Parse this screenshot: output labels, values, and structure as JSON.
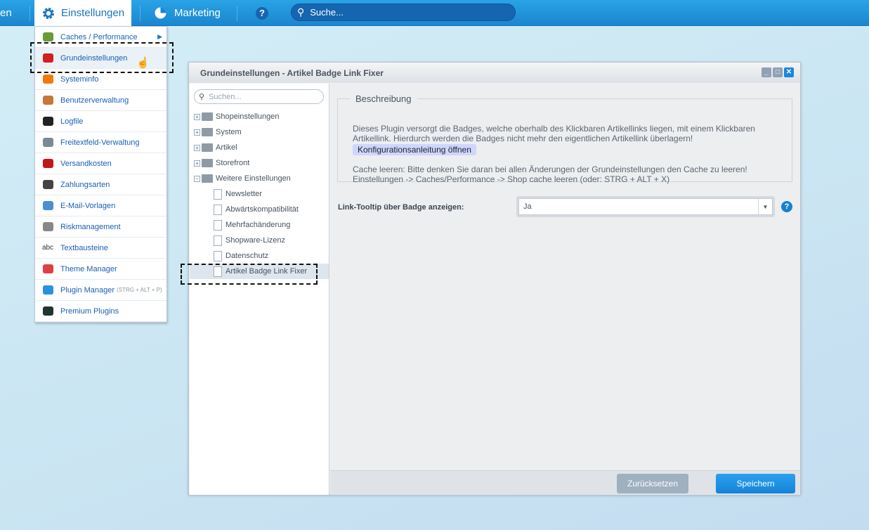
{
  "topbar": {
    "partial_item": "en",
    "settings": "Einstellungen",
    "marketing": "Marketing",
    "search_placeholder": "Suche..."
  },
  "menu": {
    "items": [
      {
        "label": "Caches / Performance",
        "icon": "gauge-icon",
        "submenu": true
      },
      {
        "label": "Grundeinstellungen",
        "icon": "wrench-icon",
        "highlighted": true
      },
      {
        "label": "Systeminfo",
        "icon": "lightning-icon"
      },
      {
        "label": "Benutzerverwaltung",
        "icon": "user-icon"
      },
      {
        "label": "Logfile",
        "icon": "terminal-icon"
      },
      {
        "label": "Freitextfeld-Verwaltung",
        "icon": "field-add-icon"
      },
      {
        "label": "Versandkosten",
        "icon": "truck-icon"
      },
      {
        "label": "Zahlungsarten",
        "icon": "credit-card-icon"
      },
      {
        "label": "E-Mail-Vorlagen",
        "icon": "email-icon"
      },
      {
        "label": "Riskmanagement",
        "icon": "filter-icon"
      },
      {
        "label": "Textbausteine",
        "icon": "abc-icon"
      },
      {
        "label": "Theme Manager",
        "icon": "palette-icon"
      },
      {
        "label": "Plugin Manager",
        "shortcut": "(STRG + ALT + P)",
        "icon": "puzzle-icon"
      },
      {
        "label": "Premium Plugins",
        "icon": "shopware-icon"
      }
    ]
  },
  "window": {
    "title": "Grundeinstellungen - Artikel Badge Link Fixer",
    "tree": {
      "search_placeholder": "Suchen...",
      "folders": [
        "Shopeinstellungen",
        "System",
        "Artikel",
        "Storefront",
        "Weitere Einstellungen"
      ],
      "children": [
        "Newsletter",
        "Abwärtskompatibilität",
        "Mehrfachänderung",
        "Shopware-Lizenz",
        "Datenschutz",
        "Artikel Badge Link Fixer"
      ]
    },
    "description": {
      "legend": "Beschreibung",
      "text": "Dieses Plugin versorgt die Badges, welche oberhalb des Klickbaren Artikellinks liegen, mit einem Klickbaren Artikellink. Hierdurch werden die Badges nicht mehr den eigentlichen Artikellink überlagern!",
      "link": "Konfigurationsanleitung öffnen",
      "cache_line1": "Cache leeren: Bitte denken Sie daran bei allen Änderungen der Grundeinstellungen den Cache zu leeren!",
      "cache_line2": "Einstellungen -> Caches/Performance -> Shop cache leeren (oder: STRG + ALT + X)"
    },
    "field": {
      "label": "Link-Tooltip über Badge anzeigen:",
      "value": "Ja"
    },
    "reset": "Zurücksetzen",
    "save": "Speichern"
  }
}
